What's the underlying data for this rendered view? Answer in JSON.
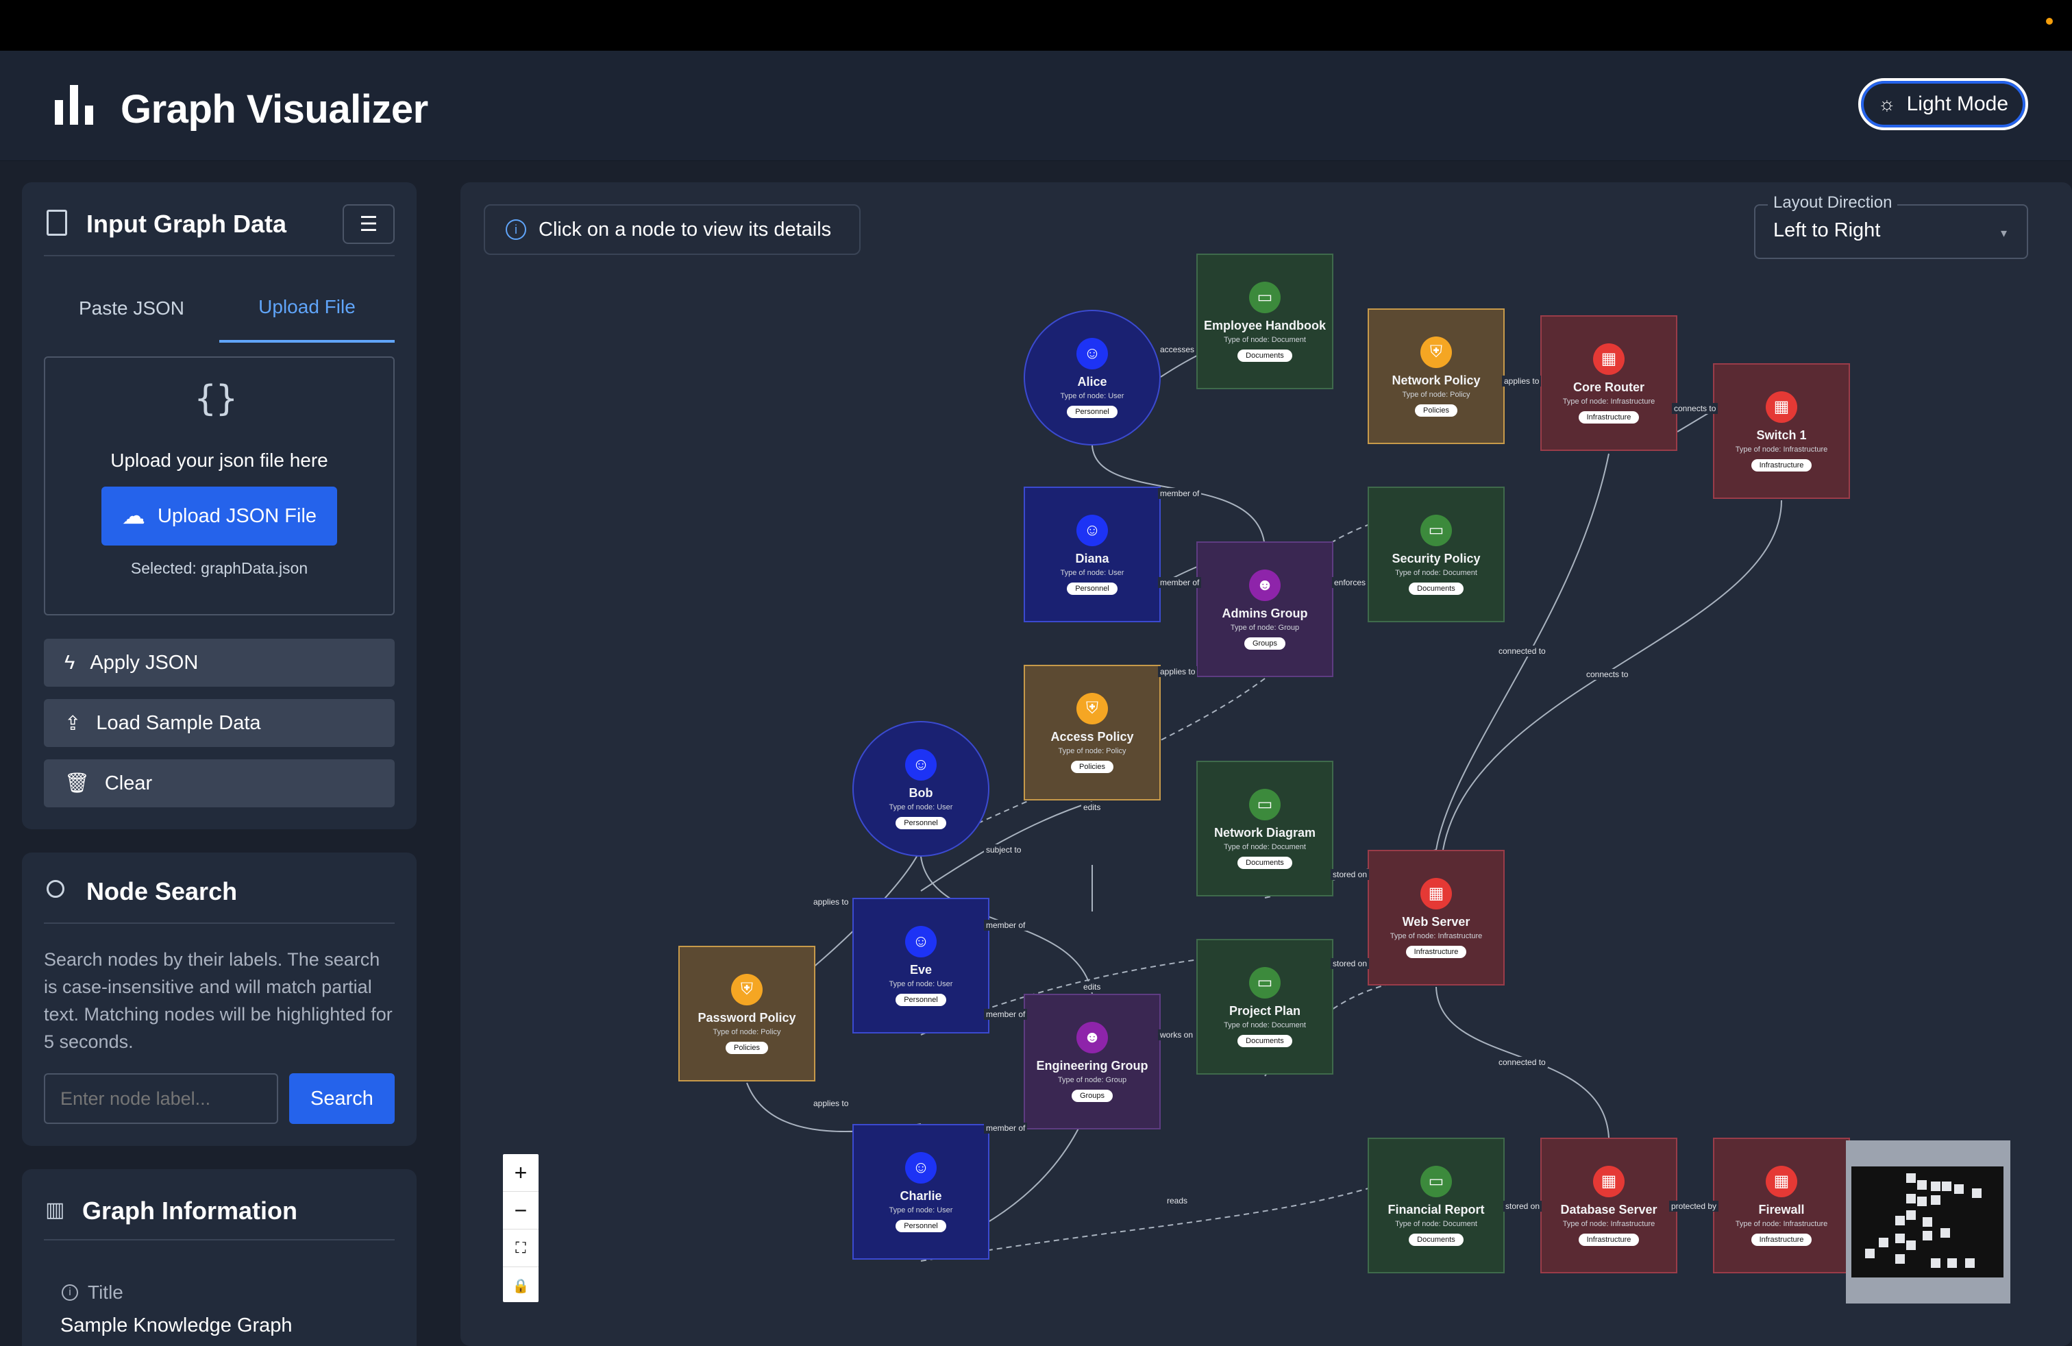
{
  "app": {
    "title": "Graph Visualizer",
    "mode_button": "Light Mode"
  },
  "input_panel": {
    "title": "Input Graph Data",
    "tabs": [
      "Paste JSON",
      "Upload File"
    ],
    "active_tab": "Upload File",
    "upload_prompt": "Upload your json file here",
    "upload_button": "Upload JSON File",
    "selected": "Selected: graphData.json",
    "apply": "Apply JSON",
    "load_sample": "Load Sample Data",
    "clear": "Clear"
  },
  "search_panel": {
    "title": "Node Search",
    "description": "Search nodes by their labels. The search is case-insensitive and will match partial text. Matching nodes will be highlighted for 5 seconds.",
    "placeholder": "Enter node label...",
    "button": "Search"
  },
  "info_panel": {
    "title": "Graph Information",
    "field_label": "Title",
    "field_value": "Sample Knowledge Graph"
  },
  "graph": {
    "banner": "Click on a node to view its details",
    "layout_label": "Layout Direction",
    "layout_value": "Left to Right",
    "nodes": [
      {
        "label": "Employee Handbook",
        "type": "Type of node: Document",
        "tag": "Documents"
      },
      {
        "label": "Alice",
        "type": "Type of node: User",
        "tag": "Personnel"
      },
      {
        "label": "Network Policy",
        "type": "Type of node: Policy",
        "tag": "Policies"
      },
      {
        "label": "Core Router",
        "type": "Type of node: Infrastructure",
        "tag": "Infrastructure"
      },
      {
        "label": "Switch 1",
        "type": "Type of node: Infrastructure",
        "tag": "Infrastructure"
      },
      {
        "label": "Diana",
        "type": "Type of node: User",
        "tag": "Personnel"
      },
      {
        "label": "Admins Group",
        "type": "Type of node: Group",
        "tag": "Groups"
      },
      {
        "label": "Security Policy",
        "type": "Type of node: Document",
        "tag": "Documents"
      },
      {
        "label": "Access Policy",
        "type": "Type of node: Policy",
        "tag": "Policies"
      },
      {
        "label": "Bob",
        "type": "Type of node: User",
        "tag": "Personnel"
      },
      {
        "label": "Network Diagram",
        "type": "Type of node: Document",
        "tag": "Documents"
      },
      {
        "label": "Web Server",
        "type": "Type of node: Infrastructure",
        "tag": "Infrastructure"
      },
      {
        "label": "Eve",
        "type": "Type of node: User",
        "tag": "Personnel"
      },
      {
        "label": "Password Policy",
        "type": "Type of node: Policy",
        "tag": "Policies"
      },
      {
        "label": "Engineering Group",
        "type": "Type of node: Group",
        "tag": "Groups"
      },
      {
        "label": "Project Plan",
        "type": "Type of node: Document",
        "tag": "Documents"
      },
      {
        "label": "Charlie",
        "type": "Type of node: User",
        "tag": "Personnel"
      },
      {
        "label": "Financial Report",
        "type": "Type of node: Document",
        "tag": "Documents"
      },
      {
        "label": "Database Server",
        "type": "Type of node: Infrastructure",
        "tag": "Infrastructure"
      },
      {
        "label": "Firewall",
        "type": "Type of node: Infrastructure",
        "tag": "Infrastructure"
      }
    ],
    "edge_labels": [
      "accesses",
      "applies to",
      "connects to",
      "member of",
      "member of",
      "enforces",
      "connected to",
      "connects to",
      "applies to",
      "edits",
      "subject to",
      "applies to",
      "member of",
      "stored on",
      "edits",
      "member of",
      "works on",
      "stored on",
      "connected to",
      "applies to",
      "member of",
      "reads",
      "stored on",
      "protected by"
    ]
  }
}
